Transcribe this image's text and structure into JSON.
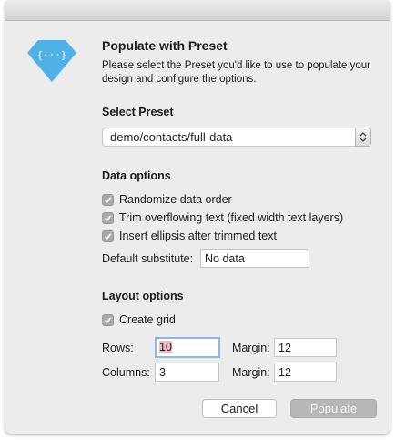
{
  "dialog": {
    "title": "Populate with Preset",
    "description": "Please select the Preset you'd like to use to populate your design and configure the options.",
    "logo_icon": "{···}"
  },
  "preset": {
    "section": "Select Preset",
    "selected": "demo/contacts/full-data"
  },
  "data_options": {
    "section": "Data options",
    "randomize": "Randomize data order",
    "trim": "Trim overflowing text (fixed width text layers)",
    "ellipsis": "Insert ellipsis after trimmed text",
    "default_label": "Default substitute:",
    "default_value": "No data"
  },
  "layout_options": {
    "section": "Layout options",
    "create_grid": "Create grid",
    "rows_label": "Rows:",
    "rows_value": "10",
    "columns_label": "Columns:",
    "columns_value": "3",
    "margin_label": "Margin:",
    "rows_margin_value": "12",
    "columns_margin_value": "12"
  },
  "buttons": {
    "cancel": "Cancel",
    "populate": "Populate"
  },
  "colors": {
    "logo": "#4fb1e8",
    "checkbox": "#a9a9a9",
    "focus_ring": "#8fb5ea"
  }
}
